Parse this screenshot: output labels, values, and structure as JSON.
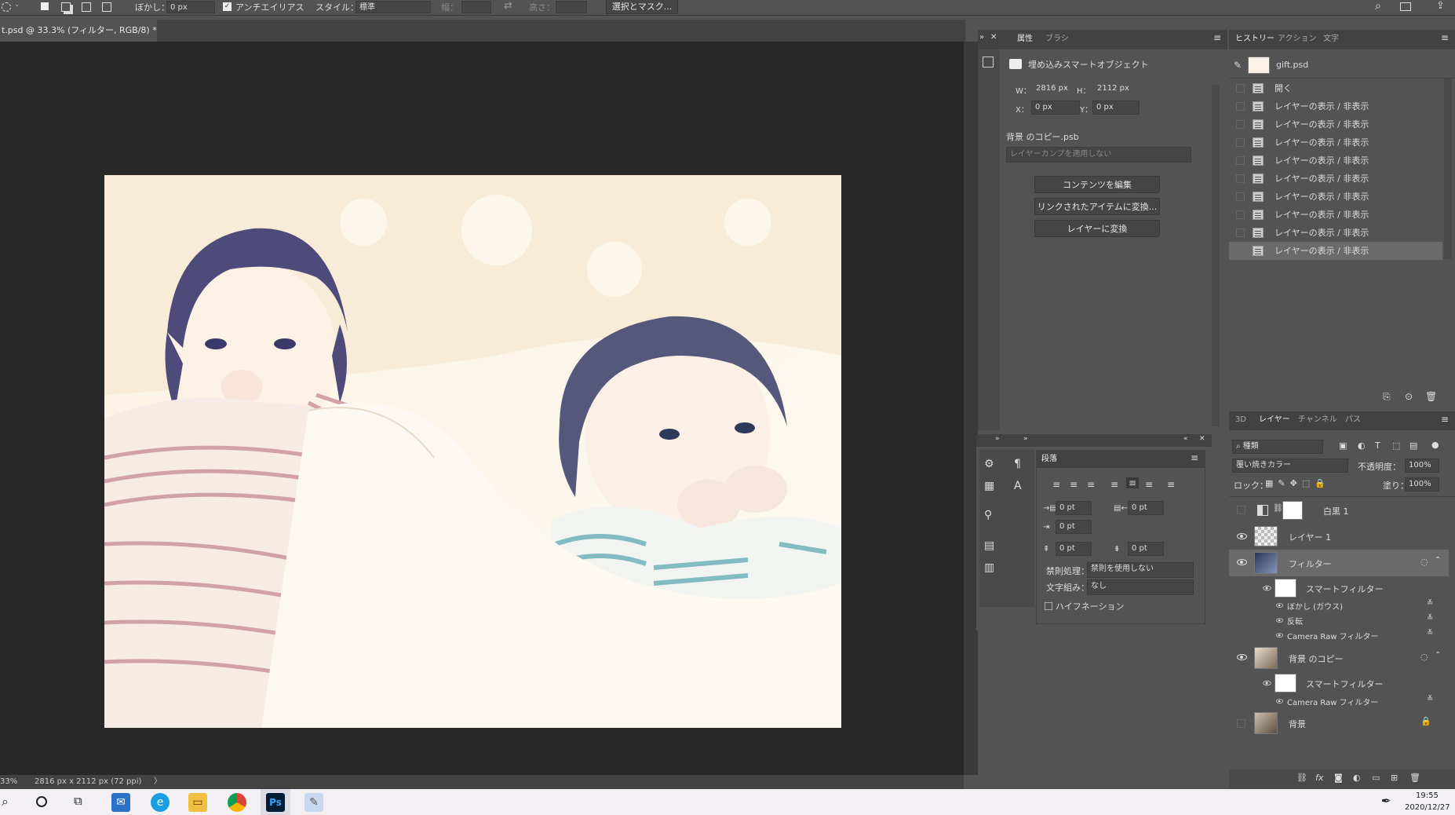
{
  "options_bar": {
    "feather_label": "ぼかし：",
    "feather_value": "0 px",
    "antialias_label": "アンチエイリアス",
    "style_label": "スタイル：",
    "style_value": "標準",
    "width_label": "幅：",
    "height_label": "高さ：",
    "select_mask_button": "選択とマスク..."
  },
  "document": {
    "tab_title": "t.psd @ 33.3% (フィルター, RGB/8) *",
    "close_glyph": "×"
  },
  "status": {
    "zoom": "33%",
    "dimensions": "2816 px x 2112 px (72 ppi)",
    "arrow": "〉"
  },
  "properties_panel": {
    "tab_properties": "属性",
    "tab_brush": "ブラシ",
    "type_label": "埋め込みスマートオブジェクト",
    "w_label": "W：",
    "w_value": "2816 px",
    "h_label": "H：",
    "h_value": "2112 px",
    "x_label": "X：",
    "x_value": "0 px",
    "y_label": "Y：",
    "y_value": "0 px",
    "filename": "背景 のコピー.psb",
    "layer_comp_placeholder": "レイヤーカンプを適用しない",
    "buttons": [
      "コンテンツを編集",
      "リンクされたアイテムに変換...",
      "レイヤーに変換"
    ]
  },
  "history_panel": {
    "tabs": [
      "ヒストリー",
      "アクション",
      "文字"
    ],
    "snapshot": "gift.psd",
    "items": [
      "開く",
      "レイヤーの表示 / 非表示",
      "レイヤーの表示 / 非表示",
      "レイヤーの表示 / 非表示",
      "レイヤーの表示 / 非表示",
      "レイヤーの表示 / 非表示",
      "レイヤーの表示 / 非表示",
      "レイヤーの表示 / 非表示",
      "レイヤーの表示 / 非表示",
      "レイヤーの表示 / 非表示"
    ]
  },
  "paragraph_panel": {
    "tab": "段落",
    "indent_left": "0 pt",
    "indent_right": "0 pt",
    "indent_first": "0 pt",
    "space_before": "0 pt",
    "space_after": "0 pt",
    "kinsoku_label": "禁則処理：",
    "kinsoku_value": "禁則を使用しない",
    "mojikumi_label": "文字組み：",
    "mojikumi_value": "なし",
    "hyphenation": "ハイフネーション"
  },
  "layers_panel": {
    "tabs": [
      "3D",
      "レイヤー",
      "チャンネル",
      "パス"
    ],
    "filter_kind": "種類",
    "blend_mode": "覆い焼きカラー",
    "opacity_label": "不透明度：",
    "opacity_value": "100%",
    "lock_label": "ロック：",
    "fill_label": "塗り：",
    "fill_value": "100%",
    "layers": {
      "bw": "白黒 1",
      "layer1": "レイヤー 1",
      "filter": "フィルター",
      "smart_filter_1": "スマートフィルター",
      "gaussian": "ぼかし (ガウス)",
      "invert": "反転",
      "camera_raw_1": "Camera Raw フィルター",
      "bg_copy": "背景 のコピー",
      "smart_filter_2": "スマートフィルター",
      "camera_raw_2": "Camera Raw フィルター",
      "background": "背景"
    }
  },
  "taskbar": {
    "time": "19:55",
    "date": "2020/12/27",
    "ps_label": "Ps"
  },
  "colors": {
    "accent_blue": "#1473e6",
    "panel_bg": "#535353",
    "workspace_bg": "#282828"
  }
}
